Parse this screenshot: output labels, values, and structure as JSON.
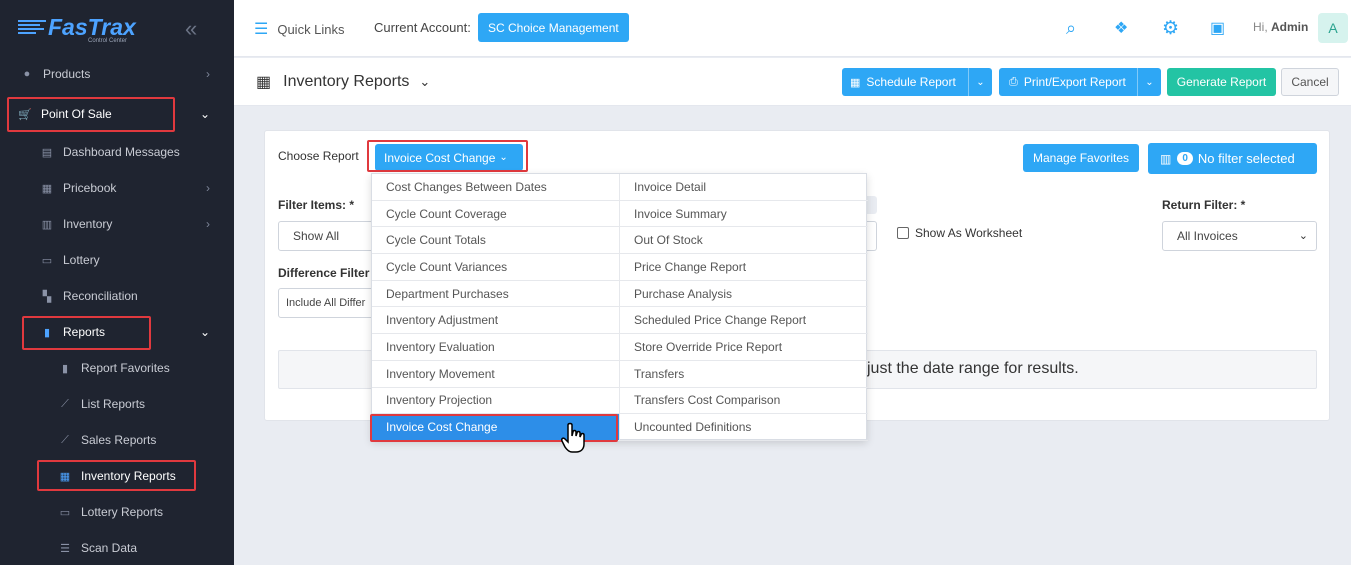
{
  "brand": {
    "name": "FasTrax",
    "tagline": "Control Center"
  },
  "sidebar": {
    "items": [
      {
        "label": "Products"
      },
      {
        "label": "Point Of Sale"
      },
      {
        "label": "Dashboard Messages"
      },
      {
        "label": "Pricebook"
      },
      {
        "label": "Inventory"
      },
      {
        "label": "Lottery"
      },
      {
        "label": "Reconciliation"
      },
      {
        "label": "Reports"
      },
      {
        "label": "Report Favorites"
      },
      {
        "label": "List Reports"
      },
      {
        "label": "Sales Reports"
      },
      {
        "label": "Inventory Reports"
      },
      {
        "label": "Lottery Reports"
      },
      {
        "label": "Scan Data"
      }
    ]
  },
  "topbar": {
    "quick_links": "Quick Links",
    "current_account_label": "Current Account:",
    "current_account_value": "SC Choice Management",
    "greeting": "Hi,",
    "user": "Admin",
    "avatar_initial": "A"
  },
  "page": {
    "title": "Inventory Reports",
    "buttons": {
      "schedule": "Schedule Report",
      "print_export": "Print/Export Report",
      "generate": "Generate Report",
      "cancel": "Cancel"
    }
  },
  "form": {
    "choose_report_label": "Choose Report",
    "choose_report_value": "Invoice Cost Change",
    "manage_favorites": "Manage Favorites",
    "filter_count": "0",
    "filter_status": "No filter selected",
    "filter_items_label": "Filter Items: *",
    "filter_items_value": "Show All",
    "difference_filter_label": "Difference Filter",
    "difference_filter_value": "Include All Differ",
    "show_as_worksheet": "Show As Worksheet",
    "return_filter_label": "Return Filter: *",
    "return_filter_value": "All Invoices",
    "info_text": "just the date range for results."
  },
  "dropdown": {
    "left": [
      "Cost Changes Between Dates",
      "Cycle Count Coverage",
      "Cycle Count Totals",
      "Cycle Count Variances",
      "Department Purchases",
      "Inventory Adjustment",
      "Inventory Evaluation",
      "Inventory Movement",
      "Inventory Projection",
      "Invoice Cost Change"
    ],
    "right": [
      "Invoice Detail",
      "Invoice Summary",
      "Out Of Stock",
      "Price Change Report",
      "Purchase Analysis",
      "Scheduled Price Change Report",
      "Store Override Price Report",
      "Transfers",
      "Transfers Cost Comparison",
      "Uncounted Definitions"
    ]
  },
  "colors": {
    "sidebar_bg": "#1f2430",
    "accent_blue": "#2ea7f5",
    "generate_green": "#23c4a4",
    "highlight_red": "#e0393e",
    "selected_blue": "#2d8ee8"
  }
}
